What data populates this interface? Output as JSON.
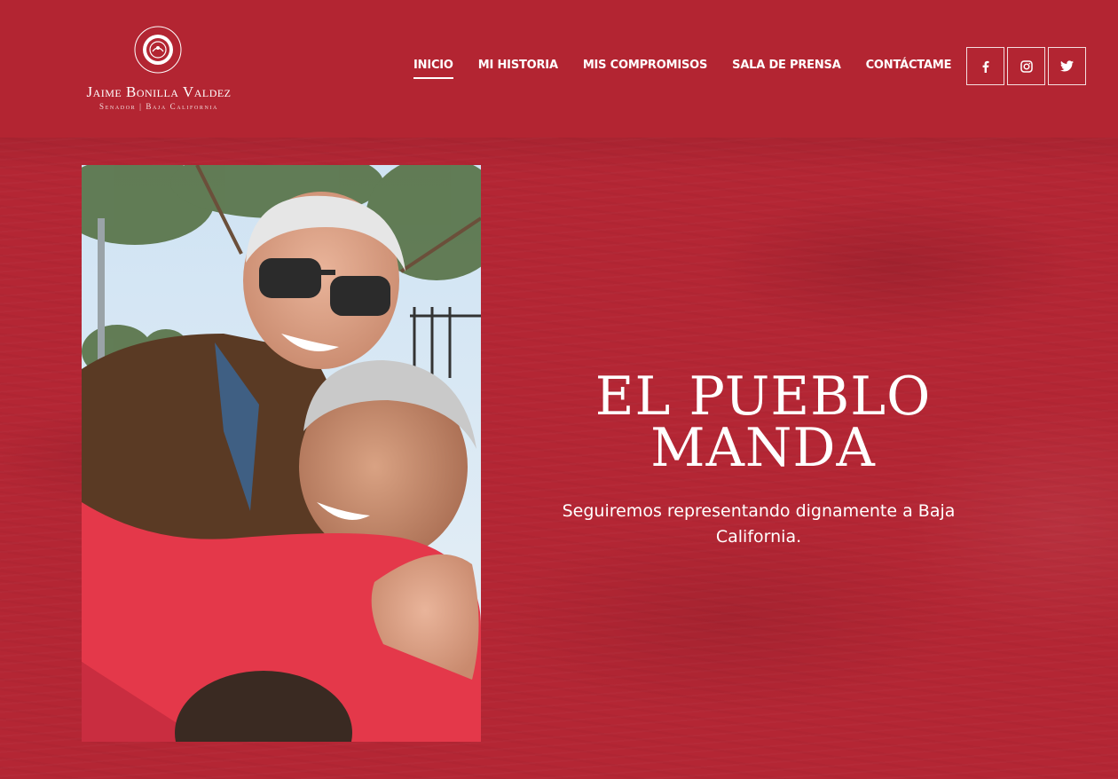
{
  "brand": {
    "name": "Jaime Bonilla Valdez",
    "subtitle": "Senador | Baja California",
    "seal_icon": "senate-seal-icon"
  },
  "nav": {
    "items": [
      {
        "label": "INICIO",
        "active": true
      },
      {
        "label": "MI HISTORIA",
        "active": false
      },
      {
        "label": "MIS COMPROMISOS",
        "active": false
      },
      {
        "label": "SALA DE PRENSA",
        "active": false
      },
      {
        "label": "CONTÁCTAME",
        "active": false
      }
    ]
  },
  "social": [
    {
      "icon": "facebook-icon",
      "glyph": "f"
    },
    {
      "icon": "instagram-icon",
      "glyph": ""
    },
    {
      "icon": "twitter-icon",
      "glyph": ""
    }
  ],
  "hero": {
    "title_line1": "EL PUEBLO",
    "title_line2": "MANDA",
    "subtitle": "Seguiremos representando dignamente a Baja California."
  },
  "colors": {
    "brand_red": "#b32532",
    "text": "#ffffff"
  }
}
